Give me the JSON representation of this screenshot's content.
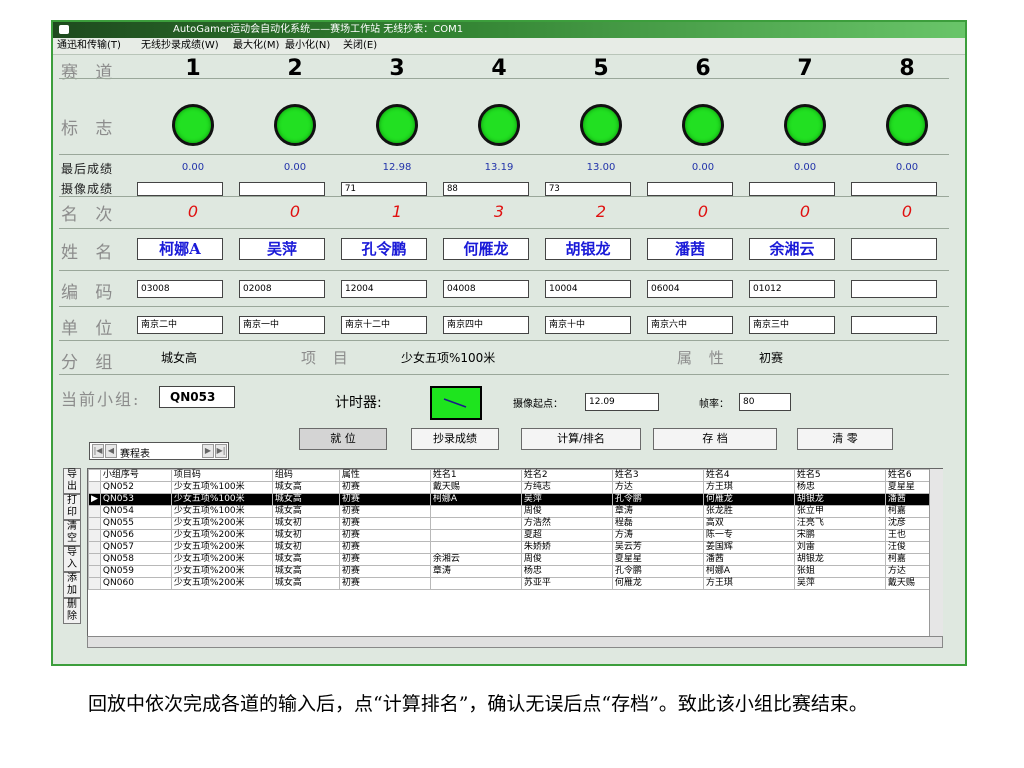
{
  "window": {
    "title": "AutoGamer运动会自动化系统——赛场工作站   无线抄表：COM1"
  },
  "menu": [
    "通迅和传输(T)",
    "无线抄录成绩(W)",
    "最大化(M)",
    "最小化(N)",
    "关闭(E)"
  ],
  "labels": {
    "lane": "赛 道",
    "flag": "标 志",
    "last_score": "最后成绩",
    "camera_score": "摄像成绩",
    "rank": "名 次",
    "name": "姓 名",
    "code": "编 码",
    "unit": "单 位",
    "group": "分 组",
    "item": "项 目",
    "attr": "属 性",
    "current_group": "当前小组:",
    "timer": "计时器:",
    "camera_start": "摄像起点：",
    "frame_rate": "帧率："
  },
  "lanes": [
    {
      "num": "1",
      "score": "0.00",
      "camera": "",
      "rank": "0",
      "name": "柯娜A",
      "code": "03008",
      "unit": "南京二中"
    },
    {
      "num": "2",
      "score": "0.00",
      "camera": "",
      "rank": "0",
      "name": "吴萍",
      "code": "02008",
      "unit": "南京一中"
    },
    {
      "num": "3",
      "score": "12.98",
      "camera": "71",
      "rank": "1",
      "name": "孔令鹏",
      "code": "12004",
      "unit": "南京十二中"
    },
    {
      "num": "4",
      "score": "13.19",
      "camera": "88",
      "rank": "3",
      "name": "何雁龙",
      "code": "04008",
      "unit": "南京四中"
    },
    {
      "num": "5",
      "score": "13.00",
      "camera": "73",
      "rank": "2",
      "name": "胡银龙",
      "code": "10004",
      "unit": "南京十中"
    },
    {
      "num": "6",
      "score": "0.00",
      "camera": "",
      "rank": "0",
      "name": "潘茜",
      "code": "06004",
      "unit": "南京六中"
    },
    {
      "num": "7",
      "score": "0.00",
      "camera": "",
      "rank": "0",
      "name": "余湘云",
      "code": "01012",
      "unit": "南京三中"
    },
    {
      "num": "8",
      "score": "0.00",
      "camera": "",
      "rank": "0",
      "name": "",
      "code": "",
      "unit": ""
    }
  ],
  "group_info": {
    "group": "城女高",
    "item": "少女五项%100米",
    "attr": "初赛",
    "current_group": "QN053",
    "camera_start": "12.09",
    "frame_rate": "80"
  },
  "nav": {
    "label": "赛程表"
  },
  "buttons": {
    "ready": "就 位",
    "record": "抄录成绩",
    "calc": "计算/排名",
    "save": "存 档",
    "clear": "清 零"
  },
  "side_buttons": [
    "导出",
    "打印",
    "清空",
    "导入",
    "添加",
    "删除"
  ],
  "table": {
    "headers": [
      "小组序号",
      "项目码",
      "组码",
      "属性",
      "姓名1",
      "姓名2",
      "姓名3",
      "姓名4",
      "姓名5",
      "姓名6"
    ],
    "rows": [
      [
        "QN052",
        "少女五项%100米",
        "城女高",
        "初赛",
        "戴天赐",
        "方纯志",
        "方达",
        "方王琪",
        "杨忠",
        "夏星星"
      ],
      [
        "QN053",
        "少女五项%100米",
        "城女高",
        "初赛",
        "柯娜A",
        "吴萍",
        "孔令鹏",
        "何雁龙",
        "胡银龙",
        "潘茜"
      ],
      [
        "QN054",
        "少女五项%100米",
        "城女高",
        "初赛",
        "",
        "周俊",
        "章涛",
        "张龙胜",
        "张立甲",
        "柯嘉"
      ],
      [
        "QN055",
        "少女五项%200米",
        "城女初",
        "初赛",
        "",
        "方浩然",
        "程磊",
        "高双",
        "汪亮飞",
        "沈彦"
      ],
      [
        "QN056",
        "少女五项%200米",
        "城女初",
        "初赛",
        "",
        "夏超",
        "方涛",
        "陈一专",
        "宋鹏",
        "王也"
      ],
      [
        "QN057",
        "少女五项%200米",
        "城女初",
        "初赛",
        "",
        "朱娇娇",
        "吴云芳",
        "姜国辉",
        "刘雷",
        "汪俊"
      ],
      [
        "QN058",
        "少女五项%200米",
        "城女高",
        "初赛",
        "余湘云",
        "周俊",
        "夏星星",
        "潘茜",
        "胡银龙",
        "柯嘉"
      ],
      [
        "QN059",
        "少女五项%200米",
        "城女高",
        "初赛",
        "章涛",
        "杨忠",
        "孔令鹏",
        "柯娜A",
        "张姐",
        "方达"
      ],
      [
        "QN060",
        "少女五项%200米",
        "城女高",
        "初赛",
        "",
        "苏亚平",
        "何雁龙",
        "方王琪",
        "吴萍",
        "戴天赐"
      ]
    ],
    "selected_index": 1
  },
  "caption": "回放中依次完成各道的输入后，点“计算排名”，确认无误后点“存档”。致此该小组比赛结束。"
}
